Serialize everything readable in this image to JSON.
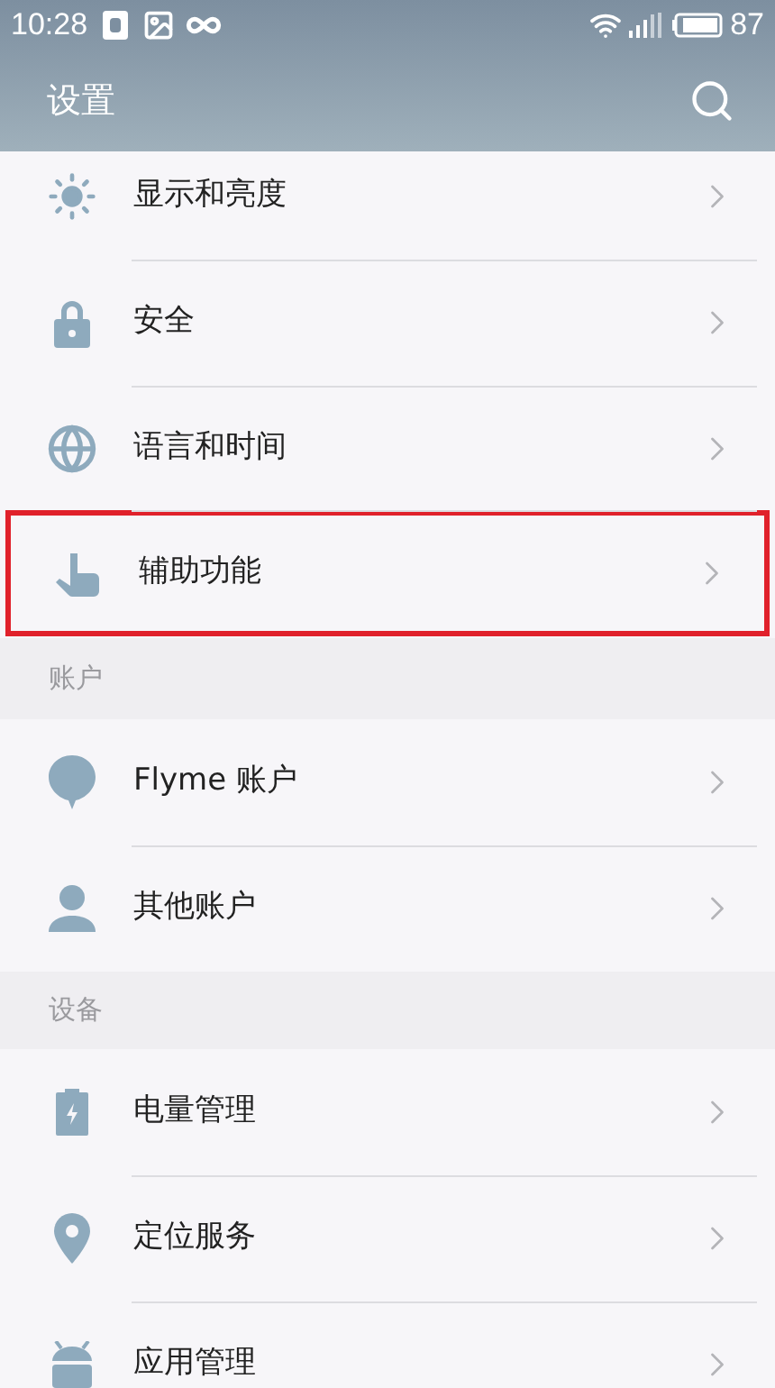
{
  "status_bar": {
    "time": "10:28",
    "battery": "87"
  },
  "app_bar": {
    "title": "设置"
  },
  "sections": [
    {
      "items": [
        {
          "label": "显示和亮度",
          "highlighted": false
        },
        {
          "label": "安全",
          "highlighted": false
        },
        {
          "label": "语言和时间",
          "highlighted": false
        },
        {
          "label": "辅助功能",
          "highlighted": true
        }
      ]
    },
    {
      "header": "账户",
      "items": [
        {
          "label": "Flyme 账户",
          "highlighted": false
        },
        {
          "label": "其他账户",
          "highlighted": false
        }
      ]
    },
    {
      "header": "设备",
      "items": [
        {
          "label": "电量管理",
          "highlighted": false
        },
        {
          "label": "定位服务",
          "highlighted": false
        },
        {
          "label": "应用管理",
          "highlighted": false
        }
      ]
    }
  ]
}
